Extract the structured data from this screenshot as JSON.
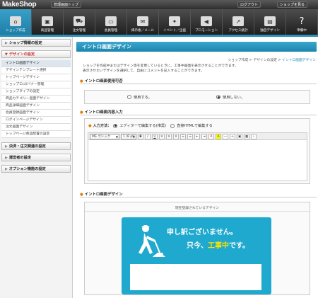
{
  "app": {
    "logo": "MakeShop"
  },
  "topbar": {
    "admin_top": "管理画面トップ",
    "logout": "ログアウト",
    "to_shop": "ショップを見る"
  },
  "nav": [
    {
      "label": "ショップ作成",
      "icon": "home-icon",
      "active": true
    },
    {
      "label": "商品管理",
      "icon": "box-icon"
    },
    {
      "label": "注文管理",
      "icon": "truck-icon"
    },
    {
      "label": "会員管理",
      "icon": "card-icon"
    },
    {
      "label": "掲示板／メール",
      "icon": "mail-icon"
    },
    {
      "label": "イベント／企画",
      "icon": "party-icon"
    },
    {
      "label": "プロモーション",
      "icon": "megaphone-icon"
    },
    {
      "label": "アクセス統計",
      "icon": "stats-icon"
    },
    {
      "label": "独自デザイン",
      "icon": "design-icon"
    },
    {
      "label": "準備中",
      "icon": "question-icon"
    }
  ],
  "sidebar": {
    "shop_info": "ショップ情報の設定",
    "design_settings": "デザインの設定",
    "items": [
      "イントロ画面デザイン",
      "デザインテンプレート選択",
      "トップページデザイン",
      "ショップロゴ/バナー管理",
      "ショップタイプの設定",
      "商品カテゴリー画面デザイン",
      "商品詳細画面デザイン",
      "会員登録画面デザイン",
      "ログインページデザイン",
      "注文画面デザイン",
      "トップページ商品配置の設定"
    ],
    "payment": "決済・注文関連の設定",
    "operator": "運営者の設定",
    "options": "オプション機能の設定"
  },
  "main": {
    "title": "イントロ画面デザイン",
    "breadcrumb": {
      "a": "ショップ作成",
      "b": "デザインの設定",
      "c": "イントロ画面デザイン",
      "sep": ">"
    },
    "intro_line1": "ショップを作成中またはデザイン等を変更しているときに、工事中画面を表示させることができます。",
    "intro_line2": "表示させたいデザインを選択して、自由にコメントを記入することができます。",
    "use_section": "イントロ画面使用可否",
    "use_yes": "使用する。",
    "use_no": "使用しない。",
    "content_section": "イントロ画面内容入力",
    "input_method_label": "入力方法：",
    "input_editor": "エディターで編集する(推奨)",
    "input_html": "直接HTMLで編集する",
    "font_select": "MS ゴシック",
    "size_select": "1 (8 pt)",
    "design_section": "イントロ画面デザイン",
    "current_design": "現在登録されているデザイン",
    "banner_msg1": "申し訳ございません。",
    "banner_msg2a": "只今、",
    "banner_msg2b": "工事中",
    "banner_msg2c": "です。"
  },
  "colors": {
    "accent": "#1fa9cf",
    "highlight": "#ffe400",
    "nav_bg": "#2e2e2e"
  }
}
